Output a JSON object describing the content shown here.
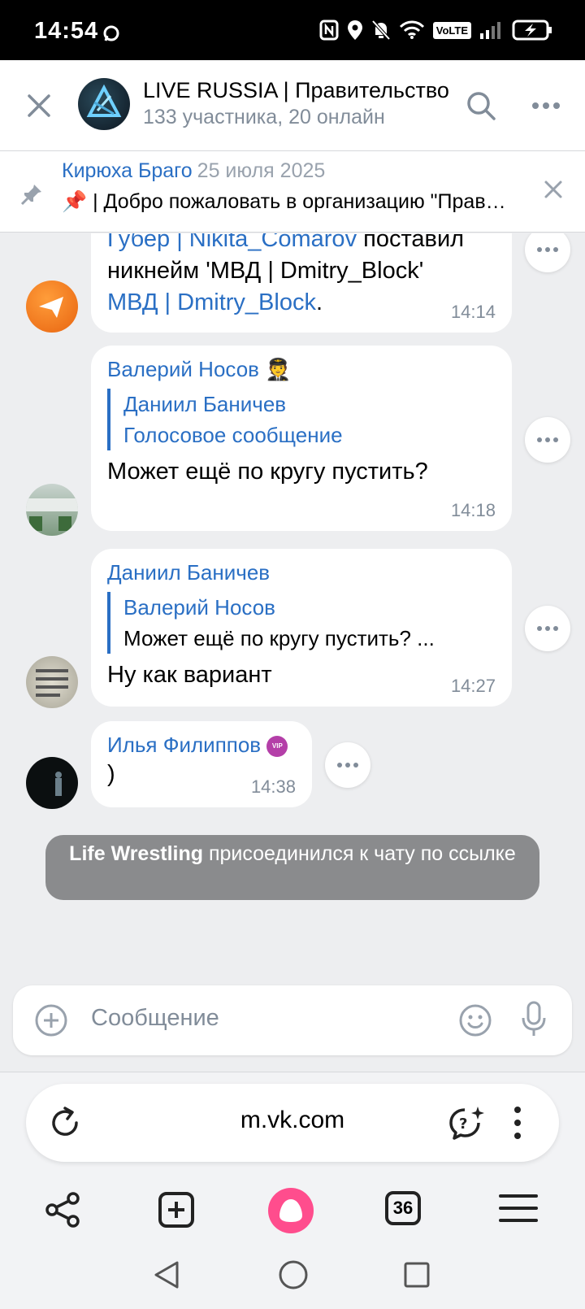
{
  "status_bar": {
    "time": "14:54",
    "icons": [
      "whatsapp-icon",
      "nfc-icon",
      "location-icon",
      "mute-icon",
      "wifi-icon",
      "volte-icon",
      "signal-icon",
      "battery-charging-icon"
    ],
    "volte_label": "VoLTE"
  },
  "header": {
    "title": "LIVE RUSSIA | Правительство",
    "subtitle": "133 участника, 20 онлайн"
  },
  "pinned": {
    "author": "Кирюха Браго",
    "date": "25 июля 2025",
    "text": "📌 | Добро пожаловать в организацию \"Правительство\""
  },
  "messages": [
    {
      "id": "m1",
      "line1_link": "Губер | Nikita_Comarov",
      "line1_text": " поставил",
      "line2_text": "никнейм 'МВД | Dmitry_Block'",
      "line3_link": "МВД | Dmitry_Block",
      "line3_text": ".",
      "time": "14:14"
    },
    {
      "id": "m2",
      "author": "Валерий Носов",
      "author_emoji": "🧑‍✈️",
      "quote_author": "Даниил Баничев",
      "quote_text": "Голосовое сообщение",
      "text": "Может ещё по кругу пустить?",
      "time": "14:18"
    },
    {
      "id": "m3",
      "author": "Даниил Баничев",
      "quote_author": "Валерий Носов",
      "quote_text": "Может ещё по кругу пустить? ...",
      "text": "Ну как вариант",
      "time": "14:27"
    },
    {
      "id": "m4",
      "author": "Илья Филиппов",
      "badge": "VIP",
      "text": ")",
      "time": "14:38"
    }
  ],
  "service_message": {
    "actor": "Life Wrestling",
    "text": " присоединился к чату по ссылке"
  },
  "composer": {
    "placeholder": "Сообщение"
  },
  "browser": {
    "url": "m.vk.com",
    "tabs_count": "36"
  },
  "colors": {
    "link": "#2a6fc4",
    "secondary_text": "#818c99",
    "chat_bg": "#edeef0",
    "alice_pink": "#ff4d8d"
  }
}
